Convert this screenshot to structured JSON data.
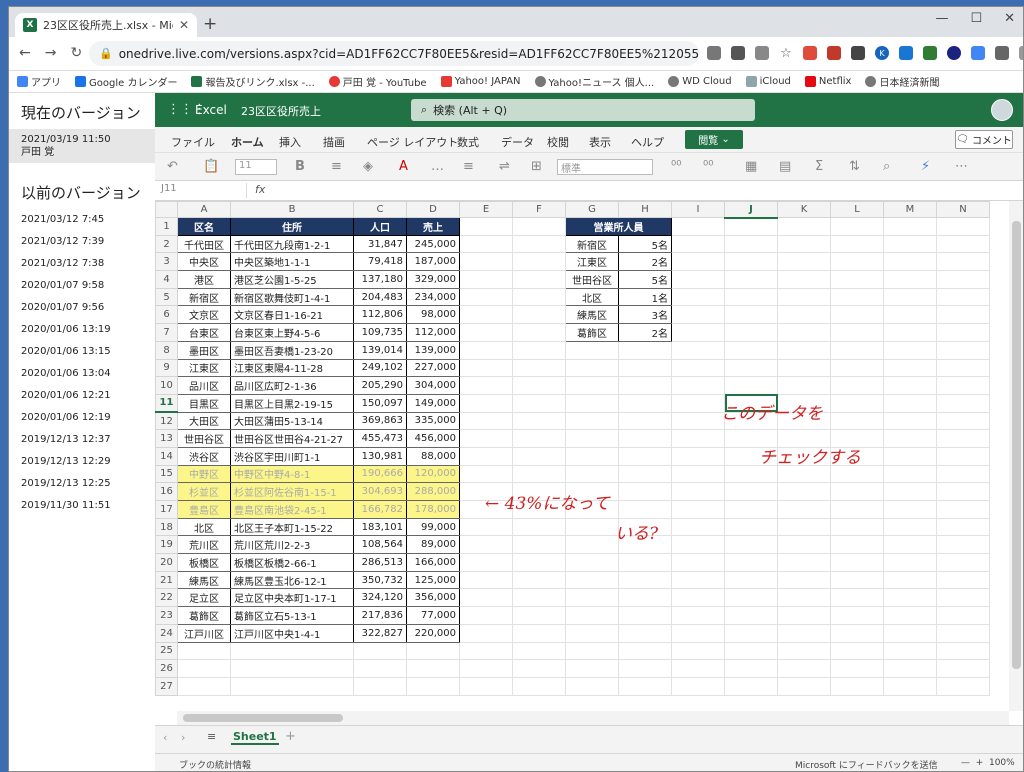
{
  "browser": {
    "tab_title": "23区区役所売上.xlsx - Microsoft ",
    "url": "onedrive.live.com/versions.aspx?cid=AD1FF62CC7F80EE5&resid=AD1FF62CC7F80EE5%21205595"
  },
  "bookmarks": [
    "アプリ",
    "Google カレンダー",
    "報告及びリンク.xlsx -...",
    "戸田 覚 - YouTube",
    "Yahoo! JAPAN",
    "Yahoo!ニュース 個人...",
    "WD Cloud",
    "iCloud",
    "Netflix",
    "日本経済新聞"
  ],
  "versions": {
    "current_title": "現在のバージョン",
    "current_date": "2021/03/19 11:50",
    "current_user": "戸田 覚",
    "prev_title": "以前のバージョン",
    "items": [
      "2021/03/12 7:45",
      "2021/03/12 7:39",
      "2021/03/12 7:38",
      "2020/01/07 9:58",
      "2020/01/07 9:56",
      "2020/01/06 13:19",
      "2020/01/06 13:15",
      "2020/01/06 13:04",
      "2020/01/06 12:21",
      "2020/01/06 12:19",
      "2019/12/13 12:37",
      "2019/12/13 12:29",
      "2019/12/13 12:25",
      "2019/11/30 11:51"
    ]
  },
  "excel": {
    "brand": "Excel",
    "file": "23区区役所売上",
    "search": "検索 (Alt + Q)",
    "tabs": [
      "ファイル",
      "ホーム",
      "挿入",
      "描画",
      "ページ レイアウト",
      "数式",
      "データ",
      "校閲",
      "表示",
      "ヘルプ"
    ],
    "view_btn": "閲覧",
    "comment_btn": "コメント",
    "font_size": "11",
    "num_format": "標準",
    "name_box": "J11",
    "fx": "fx",
    "sheet": "Sheet1",
    "status_left": "ブックの統計情報",
    "status_feedback": "Microsoft にフィードバックを送信",
    "zoom": "100%"
  },
  "columns": [
    "A",
    "B",
    "C",
    "D",
    "E",
    "F",
    "G",
    "H",
    "I",
    "J",
    "K",
    "L",
    "M",
    "N"
  ],
  "table1": {
    "headers": [
      "区名",
      "住所",
      "人口",
      "売上"
    ],
    "rows": [
      [
        "千代田区",
        "千代田区九段南1-2-1",
        "31,847",
        "245,000"
      ],
      [
        "中央区",
        "中央区築地1-1-1",
        "79,418",
        "187,000"
      ],
      [
        "港区",
        "港区芝公園1-5-25",
        "137,180",
        "329,000"
      ],
      [
        "新宿区",
        "新宿区歌舞伎町1-4-1",
        "204,483",
        "234,000"
      ],
      [
        "文京区",
        "文京区春日1-16-21",
        "112,806",
        "98,000"
      ],
      [
        "台東区",
        "台東区東上野4-5-6",
        "109,735",
        "112,000"
      ],
      [
        "墨田区",
        "墨田区吾妻橋1-23-20",
        "139,014",
        "139,000"
      ],
      [
        "江東区",
        "江東区東陽4-11-28",
        "249,102",
        "227,000"
      ],
      [
        "品川区",
        "品川区広町2-1-36",
        "205,290",
        "304,000"
      ],
      [
        "目黒区",
        "目黒区上目黒2-19-15",
        "150,097",
        "149,000"
      ],
      [
        "大田区",
        "大田区蒲田5-13-14",
        "369,863",
        "335,000"
      ],
      [
        "世田谷区",
        "世田谷区世田谷4-21-27",
        "455,473",
        "456,000"
      ],
      [
        "渋谷区",
        "渋谷区宇田川町1-1",
        "130,981",
        "88,000"
      ],
      [
        "中野区",
        "中野区中野4-8-1",
        "190,666",
        "120,000"
      ],
      [
        "杉並区",
        "杉並区阿佐谷南1-15-1",
        "304,693",
        "288,000"
      ],
      [
        "豊島区",
        "豊島区南池袋2-45-1",
        "166,782",
        "178,000"
      ],
      [
        "北区",
        "北区王子本町1-15-22",
        "183,101",
        "99,000"
      ],
      [
        "荒川区",
        "荒川区荒川2-2-3",
        "108,564",
        "89,000"
      ],
      [
        "板橋区",
        "板橋区板橋2-66-1",
        "286,513",
        "166,000"
      ],
      [
        "練馬区",
        "練馬区豊玉北6-12-1",
        "350,732",
        "125,000"
      ],
      [
        "足立区",
        "足立区中央本町1-17-1",
        "324,120",
        "356,000"
      ],
      [
        "葛飾区",
        "葛飾区立石5-13-1",
        "217,836",
        "77,000"
      ],
      [
        "江戸川区",
        "江戸川区中央1-4-1",
        "322,827",
        "220,000"
      ]
    ]
  },
  "table2": {
    "header": "営業所人員",
    "rows": [
      [
        "新宿区",
        "5名"
      ],
      [
        "江東区",
        "2名"
      ],
      [
        "世田谷区",
        "5名"
      ],
      [
        "北区",
        "1名"
      ],
      [
        "練馬区",
        "3名"
      ],
      [
        "葛飾区",
        "2名"
      ]
    ]
  },
  "annotations": {
    "a1": "このデータを",
    "a2": "チェックする",
    "a3": "← 43%になって",
    "a4": "いる?"
  }
}
